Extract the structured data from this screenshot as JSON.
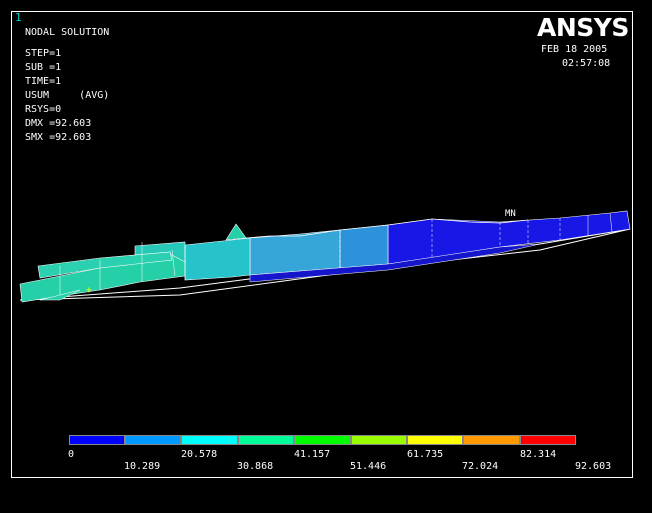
{
  "window_number": "1",
  "logo_text": "ANSYS",
  "header": {
    "lines": [
      "NODAL SOLUTION",
      "",
      "STEP=1",
      "SUB =1",
      "TIME=1",
      "USUM     (AVG)",
      "RSYS=0",
      "DMX =92.603",
      "SMX =92.603"
    ]
  },
  "date": "FEB 18 2005",
  "time": "02:57:08",
  "markers": {
    "min": "MN"
  },
  "colors": {
    "legend": [
      "#0000ff",
      "#0099ff",
      "#00ffff",
      "#00ff99",
      "#00ff00",
      "#99ff00",
      "#ffff00",
      "#ff9900",
      "#ff0000"
    ],
    "model": {
      "blue": "#1515e0",
      "mid_blue": "#2a8ed8",
      "light_blue": "#38a8d8",
      "cyan": "#22c8c8",
      "green_cyan": "#25d0a8"
    }
  },
  "legend": {
    "labels_top": [
      "0",
      "20.578",
      "41.157",
      "61.735",
      "82.314"
    ],
    "labels_bottom": [
      "10.289",
      "30.868",
      "51.446",
      "72.024",
      "92.603"
    ]
  }
}
